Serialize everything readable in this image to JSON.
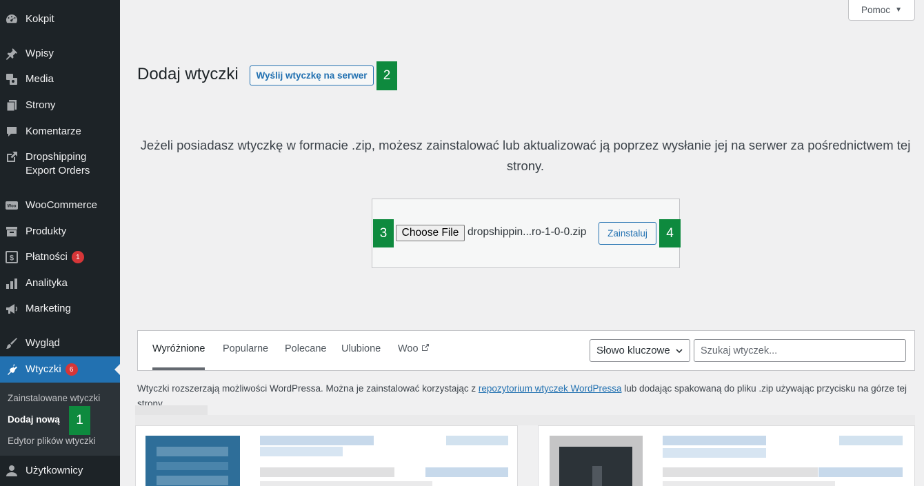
{
  "sidebar": {
    "items": [
      {
        "id": "kokpit",
        "label": "Kokpit",
        "icon": "dashboard-icon"
      },
      {
        "id": "wpisy",
        "label": "Wpisy",
        "icon": "pin-icon"
      },
      {
        "id": "media",
        "label": "Media",
        "icon": "media-icon"
      },
      {
        "id": "strony",
        "label": "Strony",
        "icon": "pages-icon"
      },
      {
        "id": "komentarze",
        "label": "Komentarze",
        "icon": "comment-icon"
      },
      {
        "id": "dropshipping",
        "label_line1": "Dropshipping",
        "label_line2": "Export Orders",
        "icon": "external-link-icon"
      },
      {
        "id": "woocommerce",
        "label": "WooCommerce",
        "icon": "woo-icon"
      },
      {
        "id": "produkty",
        "label": "Produkty",
        "icon": "archive-icon"
      },
      {
        "id": "platnosci",
        "label": "Płatności",
        "icon": "dollar-icon",
        "badge": "1"
      },
      {
        "id": "analityka",
        "label": "Analityka",
        "icon": "bar-chart-icon"
      },
      {
        "id": "marketing",
        "label": "Marketing",
        "icon": "megaphone-icon"
      },
      {
        "id": "wyglad",
        "label": "Wygląd",
        "icon": "brush-icon"
      },
      {
        "id": "wtyczki",
        "label": "Wtyczki",
        "icon": "plugin-icon",
        "badge": "6",
        "active": true
      },
      {
        "id": "uzytkownicy",
        "label": "Użytkownicy",
        "icon": "user-icon"
      }
    ],
    "submenu": [
      {
        "label": "Zainstalowane wtyczki"
      },
      {
        "label": "Dodaj nową",
        "current": true
      },
      {
        "label": "Edytor plików wtyczki"
      }
    ]
  },
  "steps": [
    "1",
    "2",
    "3",
    "4"
  ],
  "help": {
    "label": "Pomoc"
  },
  "header": {
    "title": "Dodaj wtyczki",
    "upload_button": "Wyślij wtyczkę na serwer"
  },
  "upload": {
    "intro": "Jeżeli posiadasz wtyczkę w formacie .zip, możesz zainstalować lub aktualizować ją poprzez wysłanie jej na serwer za pośrednictwem tej strony.",
    "choose_file_label": "Choose File",
    "file_name": "dropshippin...ro-1-0-0.zip",
    "install_button": "Zainstaluj"
  },
  "filter": {
    "tabs": [
      {
        "label": "Wyróżnione",
        "current": true
      },
      {
        "label": "Popularne"
      },
      {
        "label": "Polecane"
      },
      {
        "label": "Ulubione"
      },
      {
        "label": "Woo",
        "external": true
      }
    ],
    "type_select": "Słowo kluczowe",
    "search_placeholder": "Szukaj wtyczek..."
  },
  "description": {
    "before": "Wtyczki rozszerzają możliwości WordPressa. Można je zainstalować korzystając z ",
    "link": "repozytorium wtyczek WordPressa",
    "after": " lub dodając spakowaną do pliku .zip używając przycisku na górze tej strony."
  },
  "colors": {
    "sidebar_bg": "#1d2327",
    "accent": "#2271b1",
    "step_marker": "#0e8a3e",
    "badge": "#d63638"
  }
}
